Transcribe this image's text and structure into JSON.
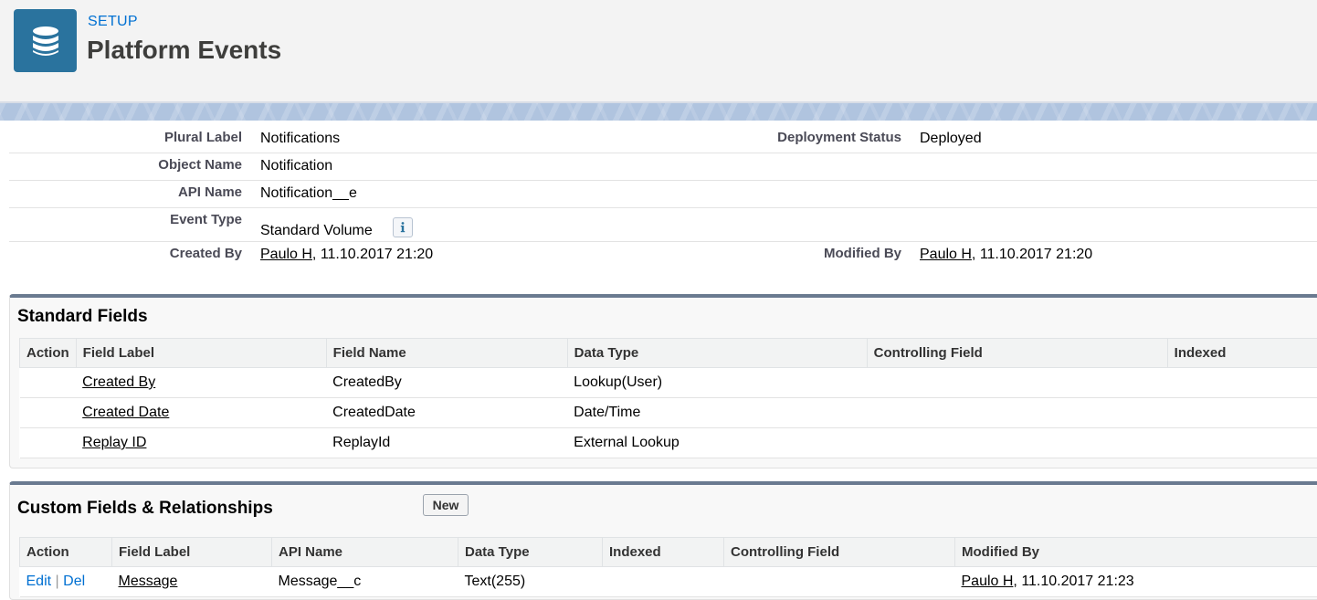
{
  "header": {
    "section_label": "SETUP",
    "title": "Platform Events",
    "icon": "database-icon"
  },
  "details": {
    "plural_label": {
      "label": "Plural Label",
      "value": "Notifications"
    },
    "deployment_status": {
      "label": "Deployment Status",
      "value": "Deployed"
    },
    "object_name": {
      "label": "Object Name",
      "value": "Notification"
    },
    "api_name": {
      "label": "API Name",
      "value": "Notification__e"
    },
    "event_type": {
      "label": "Event Type",
      "value": "Standard Volume",
      "info_icon": "info-icon"
    },
    "created_by": {
      "label": "Created By",
      "user": "Paulo H",
      "date": ", 11.10.2017 21:20"
    },
    "modified_by": {
      "label": "Modified By",
      "user": "Paulo H",
      "date": ", 11.10.2017 21:20"
    }
  },
  "standard_fields": {
    "title": "Standard Fields",
    "columns": [
      "Action",
      "Field Label",
      "Field Name",
      "Data Type",
      "Controlling Field",
      "Indexed"
    ],
    "rows": [
      {
        "label": "Created By",
        "name": "CreatedBy",
        "type": "Lookup(User)"
      },
      {
        "label": "Created Date",
        "name": "CreatedDate",
        "type": "Date/Time"
      },
      {
        "label": "Replay ID",
        "name": "ReplayId",
        "type": "External Lookup"
      }
    ]
  },
  "custom_fields": {
    "title": "Custom Fields & Relationships",
    "new_button": "New",
    "columns": [
      "Action",
      "Field Label",
      "API Name",
      "Data Type",
      "Indexed",
      "Controlling Field",
      "Modified By"
    ],
    "rows": [
      {
        "edit": "Edit",
        "sep": "|",
        "del": "Del",
        "label": "Message",
        "api": "Message__c",
        "type": "Text(255)",
        "modified_user": "Paulo H",
        "modified_date": ", 11.10.2017 21:23"
      }
    ]
  },
  "colors": {
    "accent": "#0070d2",
    "header_icon_bg": "#2a739e",
    "list_border": "#6a7a90"
  }
}
